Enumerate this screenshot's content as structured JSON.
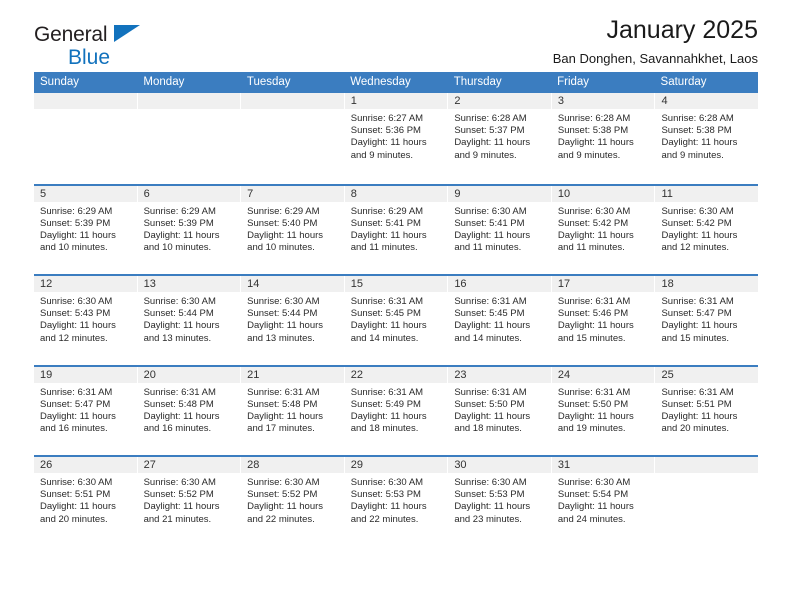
{
  "brand": {
    "line1": "General",
    "line2": "Blue",
    "flag_icon": "triangle-flag-icon",
    "color_dark": "#231f20",
    "color_blue": "#1272bd"
  },
  "header": {
    "title": "January 2025",
    "subtitle": "Ban Donghen, Savannahkhet, Laos"
  },
  "theme": {
    "header_blue": "#3b7dc0",
    "daynum_bg": "#f0f0f0",
    "text": "#2a2a2a"
  },
  "weekdays": [
    "Sunday",
    "Monday",
    "Tuesday",
    "Wednesday",
    "Thursday",
    "Friday",
    "Saturday"
  ],
  "weeks": [
    [
      {
        "day": "",
        "empty": true
      },
      {
        "day": "",
        "empty": true
      },
      {
        "day": "",
        "empty": true
      },
      {
        "day": "1",
        "sunrise": "Sunrise: 6:27 AM",
        "sunset": "Sunset: 5:36 PM",
        "daylight1": "Daylight: 11 hours",
        "daylight2": "and 9 minutes."
      },
      {
        "day": "2",
        "sunrise": "Sunrise: 6:28 AM",
        "sunset": "Sunset: 5:37 PM",
        "daylight1": "Daylight: 11 hours",
        "daylight2": "and 9 minutes."
      },
      {
        "day": "3",
        "sunrise": "Sunrise: 6:28 AM",
        "sunset": "Sunset: 5:38 PM",
        "daylight1": "Daylight: 11 hours",
        "daylight2": "and 9 minutes."
      },
      {
        "day": "4",
        "sunrise": "Sunrise: 6:28 AM",
        "sunset": "Sunset: 5:38 PM",
        "daylight1": "Daylight: 11 hours",
        "daylight2": "and 9 minutes."
      }
    ],
    [
      {
        "day": "5",
        "sunrise": "Sunrise: 6:29 AM",
        "sunset": "Sunset: 5:39 PM",
        "daylight1": "Daylight: 11 hours",
        "daylight2": "and 10 minutes."
      },
      {
        "day": "6",
        "sunrise": "Sunrise: 6:29 AM",
        "sunset": "Sunset: 5:39 PM",
        "daylight1": "Daylight: 11 hours",
        "daylight2": "and 10 minutes."
      },
      {
        "day": "7",
        "sunrise": "Sunrise: 6:29 AM",
        "sunset": "Sunset: 5:40 PM",
        "daylight1": "Daylight: 11 hours",
        "daylight2": "and 10 minutes."
      },
      {
        "day": "8",
        "sunrise": "Sunrise: 6:29 AM",
        "sunset": "Sunset: 5:41 PM",
        "daylight1": "Daylight: 11 hours",
        "daylight2": "and 11 minutes."
      },
      {
        "day": "9",
        "sunrise": "Sunrise: 6:30 AM",
        "sunset": "Sunset: 5:41 PM",
        "daylight1": "Daylight: 11 hours",
        "daylight2": "and 11 minutes."
      },
      {
        "day": "10",
        "sunrise": "Sunrise: 6:30 AM",
        "sunset": "Sunset: 5:42 PM",
        "daylight1": "Daylight: 11 hours",
        "daylight2": "and 11 minutes."
      },
      {
        "day": "11",
        "sunrise": "Sunrise: 6:30 AM",
        "sunset": "Sunset: 5:42 PM",
        "daylight1": "Daylight: 11 hours",
        "daylight2": "and 12 minutes."
      }
    ],
    [
      {
        "day": "12",
        "sunrise": "Sunrise: 6:30 AM",
        "sunset": "Sunset: 5:43 PM",
        "daylight1": "Daylight: 11 hours",
        "daylight2": "and 12 minutes."
      },
      {
        "day": "13",
        "sunrise": "Sunrise: 6:30 AM",
        "sunset": "Sunset: 5:44 PM",
        "daylight1": "Daylight: 11 hours",
        "daylight2": "and 13 minutes."
      },
      {
        "day": "14",
        "sunrise": "Sunrise: 6:30 AM",
        "sunset": "Sunset: 5:44 PM",
        "daylight1": "Daylight: 11 hours",
        "daylight2": "and 13 minutes."
      },
      {
        "day": "15",
        "sunrise": "Sunrise: 6:31 AM",
        "sunset": "Sunset: 5:45 PM",
        "daylight1": "Daylight: 11 hours",
        "daylight2": "and 14 minutes."
      },
      {
        "day": "16",
        "sunrise": "Sunrise: 6:31 AM",
        "sunset": "Sunset: 5:45 PM",
        "daylight1": "Daylight: 11 hours",
        "daylight2": "and 14 minutes."
      },
      {
        "day": "17",
        "sunrise": "Sunrise: 6:31 AM",
        "sunset": "Sunset: 5:46 PM",
        "daylight1": "Daylight: 11 hours",
        "daylight2": "and 15 minutes."
      },
      {
        "day": "18",
        "sunrise": "Sunrise: 6:31 AM",
        "sunset": "Sunset: 5:47 PM",
        "daylight1": "Daylight: 11 hours",
        "daylight2": "and 15 minutes."
      }
    ],
    [
      {
        "day": "19",
        "sunrise": "Sunrise: 6:31 AM",
        "sunset": "Sunset: 5:47 PM",
        "daylight1": "Daylight: 11 hours",
        "daylight2": "and 16 minutes."
      },
      {
        "day": "20",
        "sunrise": "Sunrise: 6:31 AM",
        "sunset": "Sunset: 5:48 PM",
        "daylight1": "Daylight: 11 hours",
        "daylight2": "and 16 minutes."
      },
      {
        "day": "21",
        "sunrise": "Sunrise: 6:31 AM",
        "sunset": "Sunset: 5:48 PM",
        "daylight1": "Daylight: 11 hours",
        "daylight2": "and 17 minutes."
      },
      {
        "day": "22",
        "sunrise": "Sunrise: 6:31 AM",
        "sunset": "Sunset: 5:49 PM",
        "daylight1": "Daylight: 11 hours",
        "daylight2": "and 18 minutes."
      },
      {
        "day": "23",
        "sunrise": "Sunrise: 6:31 AM",
        "sunset": "Sunset: 5:50 PM",
        "daylight1": "Daylight: 11 hours",
        "daylight2": "and 18 minutes."
      },
      {
        "day": "24",
        "sunrise": "Sunrise: 6:31 AM",
        "sunset": "Sunset: 5:50 PM",
        "daylight1": "Daylight: 11 hours",
        "daylight2": "and 19 minutes."
      },
      {
        "day": "25",
        "sunrise": "Sunrise: 6:31 AM",
        "sunset": "Sunset: 5:51 PM",
        "daylight1": "Daylight: 11 hours",
        "daylight2": "and 20 minutes."
      }
    ],
    [
      {
        "day": "26",
        "sunrise": "Sunrise: 6:30 AM",
        "sunset": "Sunset: 5:51 PM",
        "daylight1": "Daylight: 11 hours",
        "daylight2": "and 20 minutes."
      },
      {
        "day": "27",
        "sunrise": "Sunrise: 6:30 AM",
        "sunset": "Sunset: 5:52 PM",
        "daylight1": "Daylight: 11 hours",
        "daylight2": "and 21 minutes."
      },
      {
        "day": "28",
        "sunrise": "Sunrise: 6:30 AM",
        "sunset": "Sunset: 5:52 PM",
        "daylight1": "Daylight: 11 hours",
        "daylight2": "and 22 minutes."
      },
      {
        "day": "29",
        "sunrise": "Sunrise: 6:30 AM",
        "sunset": "Sunset: 5:53 PM",
        "daylight1": "Daylight: 11 hours",
        "daylight2": "and 22 minutes."
      },
      {
        "day": "30",
        "sunrise": "Sunrise: 6:30 AM",
        "sunset": "Sunset: 5:53 PM",
        "daylight1": "Daylight: 11 hours",
        "daylight2": "and 23 minutes."
      },
      {
        "day": "31",
        "sunrise": "Sunrise: 6:30 AM",
        "sunset": "Sunset: 5:54 PM",
        "daylight1": "Daylight: 11 hours",
        "daylight2": "and 24 minutes."
      },
      {
        "day": "",
        "empty": true
      }
    ]
  ]
}
